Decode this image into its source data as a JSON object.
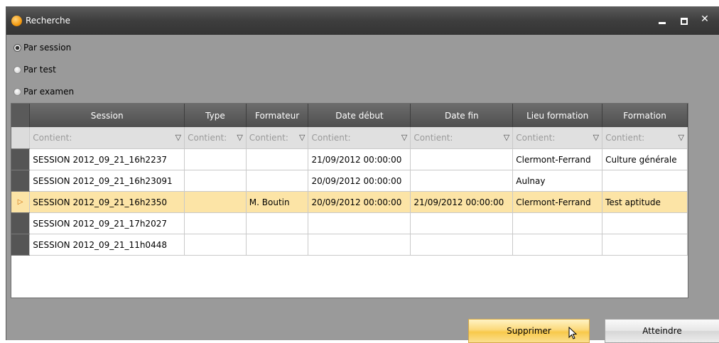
{
  "window": {
    "title": "Recherche"
  },
  "search_modes": [
    {
      "label": "Par session",
      "checked": true
    },
    {
      "label": "Par test",
      "checked": false
    },
    {
      "label": "Par examen",
      "checked": false
    }
  ],
  "grid": {
    "columns": [
      "Session",
      "Type",
      "Formateur",
      "Date début",
      "Date fin",
      "Lieu formation",
      "Formation"
    ],
    "filter_placeholder": "Contient:",
    "rows": [
      [
        "SESSION 2012_09_21_16h2237",
        "",
        "",
        "21/09/2012 00:00:00",
        "",
        "Clermont-Ferrand",
        "Culture générale"
      ],
      [
        "SESSION 2012_09_21_16h23091",
        "",
        "",
        "20/09/2012 00:00:00",
        "",
        "Aulnay",
        ""
      ],
      [
        "SESSION 2012_09_21_16h2350",
        "",
        "M. Boutin",
        "20/09/2012 00:00:00",
        "21/09/2012 00:00:00",
        "Clermont-Ferrand",
        "Test aptitude"
      ],
      [
        "SESSION 2012_09_21_17h2027",
        "",
        "",
        "",
        "",
        "",
        ""
      ],
      [
        "SESSION 2012_09_21_11h0448",
        "",
        "",
        "",
        "",
        "",
        ""
      ]
    ],
    "selected_row": 2
  },
  "buttons": {
    "supprimer": "Supprimer",
    "atteindre": "Atteindre"
  },
  "icons": {
    "filter": "filter-icon",
    "row_indicator": "row-indicator-arrow-icon",
    "app": "app-icon"
  },
  "colors": {
    "selected_row": "#fce4a6",
    "header": "#5a5a5a",
    "accent_button": "#f8c94a"
  }
}
